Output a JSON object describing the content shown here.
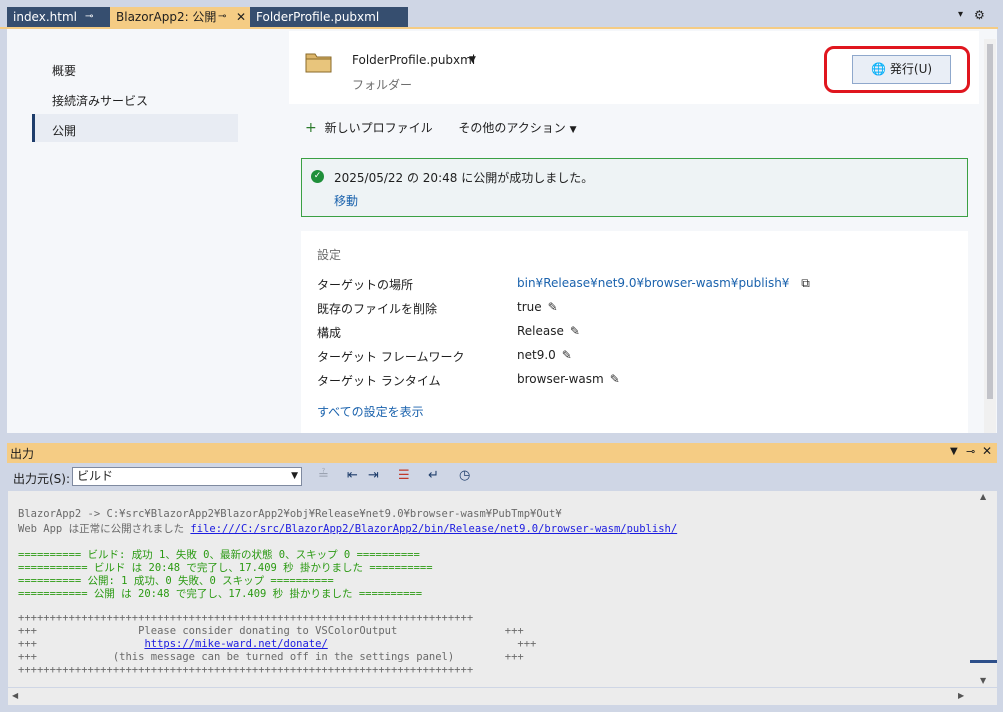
{
  "tabs": [
    {
      "label": "index.html",
      "active": false
    },
    {
      "label": "BlazorApp2: 公開",
      "active": true
    },
    {
      "label": "FolderProfile.pubxml",
      "active": false
    }
  ],
  "icons": {
    "pin": "pin-icon",
    "close": "close-icon",
    "folder": "folder-icon",
    "publish": "publish-globe-icon",
    "success": "check-circle-icon",
    "copy": "copy-icon",
    "edit": "pencil-icon"
  },
  "nav": {
    "items": [
      {
        "label": "概要"
      },
      {
        "label": "接続済みサービス"
      },
      {
        "label": "公開",
        "selected": true
      }
    ]
  },
  "profile": {
    "name": "FolderProfile.pubxml",
    "subtitle": "フォルダー",
    "publish_label": "発行(U)"
  },
  "actions": {
    "plus": "+",
    "new_profile": "新しいプロファイル",
    "other_actions": "その他のアクション"
  },
  "success": {
    "message": "2025/05/22 の 20:48 に公開が成功しました。",
    "link": "移動"
  },
  "settings": {
    "title": "設定",
    "rows": [
      {
        "label": "ターゲットの場所",
        "value": "bin¥Release¥net9.0¥browser-wasm¥publish¥",
        "link": true
      },
      {
        "label": "既存のファイルを削除",
        "value": "true"
      },
      {
        "label": "構成",
        "value": "Release"
      },
      {
        "label": "ターゲット フレームワーク",
        "value": "net9.0"
      },
      {
        "label": "ターゲット ランタイム",
        "value": "browser-wasm"
      }
    ],
    "show_all": "すべての設定を表示"
  },
  "output": {
    "title": "出力",
    "source_label": "出力元(S):",
    "source_value": "ビルド",
    "lines": {
      "l1": "BlazorApp2 -> C:¥src¥BlazorApp2¥BlazorApp2¥obj¥Release¥net9.0¥browser-wasm¥PubTmp¥Out¥",
      "l2_prefix": "Web App は正常に公開されました ",
      "l2_link": "file:///C:/src/BlazorApp2/BlazorApp2/bin/Release/net9.0/browser-wasm/publish/",
      "l3": "========== ビルド: 成功 1、失敗 0、最新の状態 0、スキップ 0 ==========",
      "l4": "=========== ビルド は 20:48 で完了し、17.409 秒 掛かりました ==========",
      "l5": "========== 公開: 1 成功、0 失敗、0 スキップ ==========",
      "l6": "=========== 公開 は 20:48 で完了し、17.409 秒 掛かりました ==========",
      "plus_border": "++++++++++++++++++++++++++++++++++++++++++++++++++++++++++++++++++++++++",
      "d1": "+++                Please consider donating to VSColorOutput                 +++",
      "d2_link": "https://mike-ward.net/donate/",
      "d3": "+++            (this message can be turned off in the settings panel)        +++"
    }
  },
  "colors": {
    "accent": "#f5cc84",
    "highlight": "#e0161e",
    "success": "#1f8f3a",
    "link": "#1a62ad"
  }
}
